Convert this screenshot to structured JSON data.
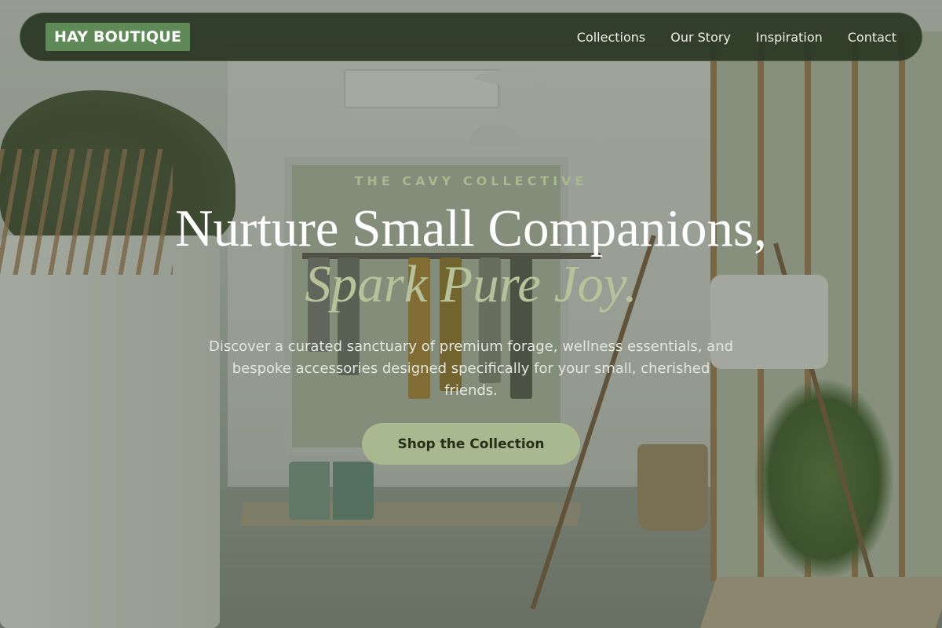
{
  "brand": {
    "logo_text": "HAY BOUTIQUE"
  },
  "nav": {
    "links": [
      {
        "label": "Collections"
      },
      {
        "label": "Our Story"
      },
      {
        "label": "Inspiration"
      },
      {
        "label": "Contact"
      }
    ]
  },
  "hero": {
    "eyebrow": "THE CAVY COLLECTIVE",
    "headline_line1": "Nurture Small Companions,",
    "headline_line2": "Spark Pure Joy.",
    "subtext": "Discover a curated sanctuary of premium forage, wellness essentials, and bespoke accessories designed specifically for your small, cherished friends.",
    "cta_label": "Shop the Collection",
    "background_image": "boutique-interior-photo"
  },
  "colors": {
    "nav_bg": "#2c3825",
    "logo_bg": "#5f8a58",
    "accent_sage": "#a8b88f",
    "headline_white": "#ffffff",
    "headline_italic": "#b8c29a"
  }
}
